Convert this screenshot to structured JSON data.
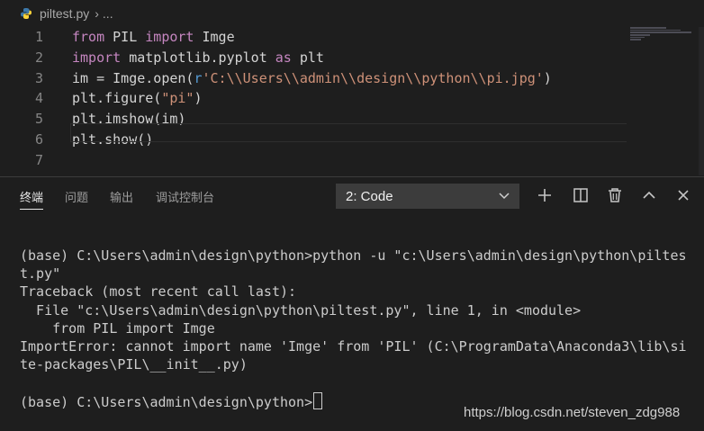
{
  "breadcrumb": {
    "file": "piltest.py",
    "more": "..."
  },
  "editor": {
    "lines": [
      {
        "n": "1",
        "tokens": [
          {
            "t": "from",
            "c": "kw"
          },
          {
            "t": " PIL ",
            "c": ""
          },
          {
            "t": "import",
            "c": "kw"
          },
          {
            "t": " Imge",
            "c": ""
          }
        ]
      },
      {
        "n": "2",
        "tokens": [
          {
            "t": "import",
            "c": "kw"
          },
          {
            "t": " matplotlib.pyplot ",
            "c": ""
          },
          {
            "t": "as",
            "c": "kw"
          },
          {
            "t": " plt",
            "c": ""
          }
        ]
      },
      {
        "n": "3",
        "tokens": [
          {
            "t": "im = Imge.open(",
            "c": ""
          },
          {
            "t": "r",
            "c": "bl"
          },
          {
            "t": "'C:\\\\Users\\\\admin\\\\design\\\\python\\\\pi.jpg'",
            "c": "str"
          },
          {
            "t": ")",
            "c": ""
          }
        ]
      },
      {
        "n": "4",
        "tokens": [
          {
            "t": "plt.figure(",
            "c": ""
          },
          {
            "t": "\"pi\"",
            "c": "str"
          },
          {
            "t": ")",
            "c": ""
          }
        ]
      },
      {
        "n": "5",
        "tokens": [
          {
            "t": "plt.imshow(im)",
            "c": ""
          }
        ]
      },
      {
        "n": "6",
        "tokens": [
          {
            "t": "plt.show()",
            "c": ""
          }
        ]
      },
      {
        "n": "7",
        "tokens": []
      }
    ]
  },
  "panel": {
    "tabs": [
      "终端",
      "问题",
      "输出",
      "调试控制台"
    ],
    "active_tab": "终端",
    "terminal_select": "2: Code",
    "icons": [
      "plus-icon",
      "split-icon",
      "trash-icon",
      "chevron-up-icon",
      "close-icon"
    ]
  },
  "terminal": {
    "lines": [
      "(base) C:\\Users\\admin\\design\\python>python -u \"c:\\Users\\admin\\design\\python\\piltes",
      "t.py\"",
      "Traceback (most recent call last):",
      "  File \"c:\\Users\\admin\\design\\python\\piltest.py\", line 1, in <module>",
      "    from PIL import Imge",
      "ImportError: cannot import name 'Imge' from 'PIL' (C:\\ProgramData\\Anaconda3\\lib\\si",
      "te-packages\\PIL\\__init__.py)",
      "",
      "(base) C:\\Users\\admin\\design\\python>"
    ]
  },
  "watermark": "https://blog.csdn.net/steven_zdg988",
  "colors": {
    "background": "#1e1e1e",
    "keyword": "#c586c0",
    "string": "#ce9178",
    "builtin": "#569cd6"
  }
}
